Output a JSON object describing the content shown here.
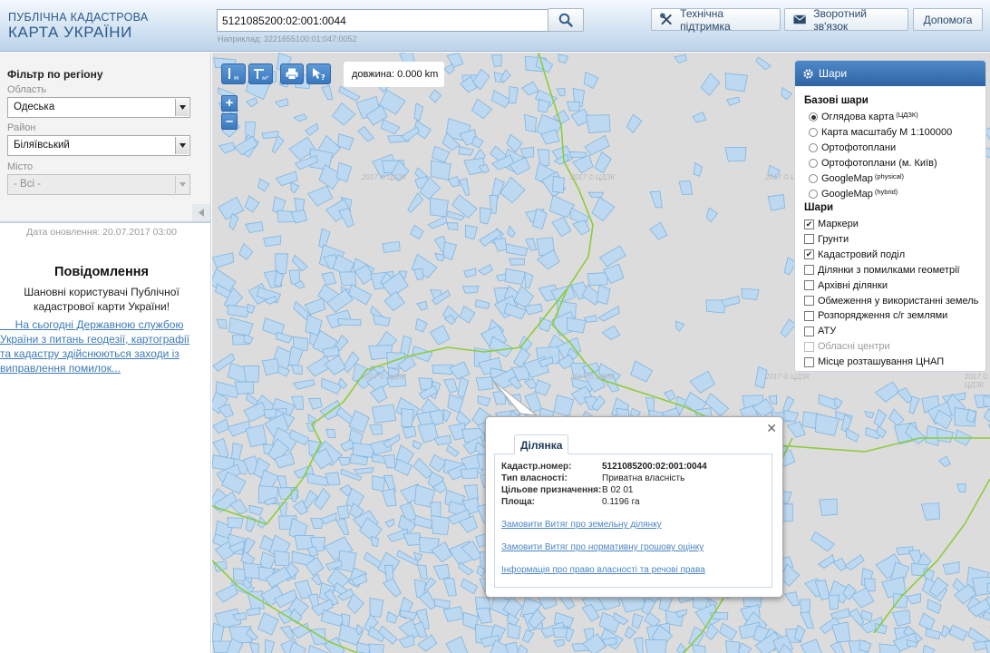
{
  "header": {
    "logo_line1": "ПУБЛІЧНА КАДАСТРОВА",
    "logo_line2": "КАРТА УКРАЇНИ",
    "search_value": "5121085200:02:001:0044",
    "search_hint": "Наприклад: 3221655100:01:047:0052",
    "buttons": {
      "support": "Технічна підтримка",
      "feedback": "Зворотний зв'язок",
      "help": "Допомога"
    },
    "icons": {
      "search": "search-icon",
      "support": "tools-icon",
      "feedback": "envelope-icon"
    }
  },
  "sidebar": {
    "filter_title": "Фільтр по регіону",
    "region_label": "Область",
    "region_value": "Одеська",
    "district_label": "Район",
    "district_value": "Біляївський",
    "city_label": "Місто",
    "city_value": "- Всі -",
    "update_date": "Дата оновлення: 20.07.2017 03:00",
    "message_title": "Повідомлення",
    "message_line1": "Шановні користувачі Публічної",
    "message_line2": "кадастрової карти України!",
    "message_link": [
      "     На сьогодні Державною службою",
      "України з питань геодезії, картографії",
      "та кадастру здійснюються заходи із",
      "виправлення помилок..."
    ]
  },
  "map": {
    "distance": "довжина: 0.000 km",
    "watermark": "2017 © ЦДЗК",
    "zoom_in": "+",
    "zoom_out": "–",
    "colors": {
      "parcel_fill": "#bdd9f1",
      "parcel_stroke": "#7fb4e0",
      "boundary": "#8ccc3a",
      "background": "#dcdcdc"
    }
  },
  "layers": {
    "title": "Шари",
    "base_title": "Базові шари",
    "base": [
      {
        "label": "Оглядова карта",
        "sup": "(ЦДЗК)",
        "selected": true
      },
      {
        "label": "Карта масштабу М 1:100000",
        "sup": "",
        "selected": false
      },
      {
        "label": "Ортофотоплани",
        "sup": "",
        "selected": false
      },
      {
        "label": "Ортофотоплани (м. Київ)",
        "sup": "",
        "selected": false
      },
      {
        "label": "GoogleMap",
        "sup": "(physical)",
        "selected": false
      },
      {
        "label": "GoogleMap",
        "sup": "(hybrid)",
        "selected": false
      }
    ],
    "overlay_title": "Шари",
    "overlays": [
      {
        "label": "Маркери",
        "checked": true
      },
      {
        "label": "Грунти",
        "checked": false
      },
      {
        "label": "Кадастровий поділ",
        "checked": true
      },
      {
        "label": "Ділянки з помилками геометрії",
        "checked": false
      },
      {
        "label": "Архівні ділянки",
        "checked": false
      },
      {
        "label": "Обмеження у використанні земель",
        "checked": false
      },
      {
        "label": "Розпорядження с/г землями",
        "checked": false
      },
      {
        "label": "АТУ",
        "checked": false
      },
      {
        "label": "Обласні центри",
        "checked": false,
        "disabled": true
      },
      {
        "label": "Місце розташування ЦНАП",
        "checked": false
      }
    ]
  },
  "popup": {
    "tab": "Ділянка",
    "rows": [
      {
        "key": "Кадастр.номер:",
        "value": "5121085200:02:001:0044"
      },
      {
        "key": "Тип власності:",
        "value": "Приватна власність"
      },
      {
        "key": "Цільове призначення:",
        "value": "В 02 01"
      },
      {
        "key": "Площа:",
        "value": "0.1196 га"
      }
    ],
    "links": [
      "Замовити Витяг про земельну ділянку",
      "Замовити Витяг про нормативну грошову оцінку",
      "Інформація про право власності та речові права"
    ]
  }
}
